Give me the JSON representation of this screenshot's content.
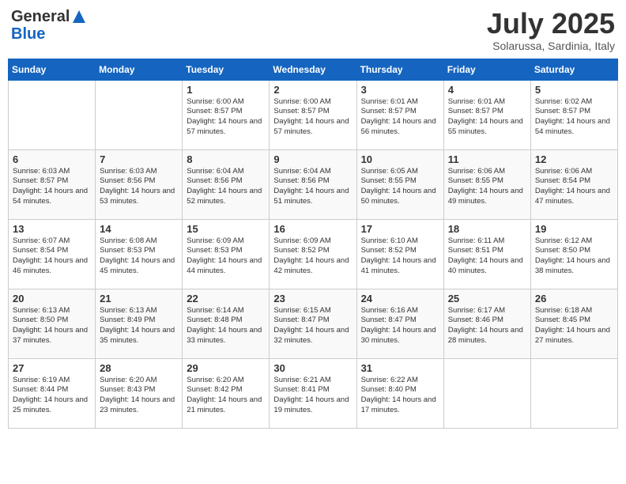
{
  "header": {
    "logo_general": "General",
    "logo_blue": "Blue",
    "month": "July 2025",
    "location": "Solarussa, Sardinia, Italy"
  },
  "days_of_week": [
    "Sunday",
    "Monday",
    "Tuesday",
    "Wednesday",
    "Thursday",
    "Friday",
    "Saturday"
  ],
  "weeks": [
    [
      {
        "day": "",
        "info": ""
      },
      {
        "day": "",
        "info": ""
      },
      {
        "day": "1",
        "info": "Sunrise: 6:00 AM\nSunset: 8:57 PM\nDaylight: 14 hours and 57 minutes."
      },
      {
        "day": "2",
        "info": "Sunrise: 6:00 AM\nSunset: 8:57 PM\nDaylight: 14 hours and 57 minutes."
      },
      {
        "day": "3",
        "info": "Sunrise: 6:01 AM\nSunset: 8:57 PM\nDaylight: 14 hours and 56 minutes."
      },
      {
        "day": "4",
        "info": "Sunrise: 6:01 AM\nSunset: 8:57 PM\nDaylight: 14 hours and 55 minutes."
      },
      {
        "day": "5",
        "info": "Sunrise: 6:02 AM\nSunset: 8:57 PM\nDaylight: 14 hours and 54 minutes."
      }
    ],
    [
      {
        "day": "6",
        "info": "Sunrise: 6:03 AM\nSunset: 8:57 PM\nDaylight: 14 hours and 54 minutes."
      },
      {
        "day": "7",
        "info": "Sunrise: 6:03 AM\nSunset: 8:56 PM\nDaylight: 14 hours and 53 minutes."
      },
      {
        "day": "8",
        "info": "Sunrise: 6:04 AM\nSunset: 8:56 PM\nDaylight: 14 hours and 52 minutes."
      },
      {
        "day": "9",
        "info": "Sunrise: 6:04 AM\nSunset: 8:56 PM\nDaylight: 14 hours and 51 minutes."
      },
      {
        "day": "10",
        "info": "Sunrise: 6:05 AM\nSunset: 8:55 PM\nDaylight: 14 hours and 50 minutes."
      },
      {
        "day": "11",
        "info": "Sunrise: 6:06 AM\nSunset: 8:55 PM\nDaylight: 14 hours and 49 minutes."
      },
      {
        "day": "12",
        "info": "Sunrise: 6:06 AM\nSunset: 8:54 PM\nDaylight: 14 hours and 47 minutes."
      }
    ],
    [
      {
        "day": "13",
        "info": "Sunrise: 6:07 AM\nSunset: 8:54 PM\nDaylight: 14 hours and 46 minutes."
      },
      {
        "day": "14",
        "info": "Sunrise: 6:08 AM\nSunset: 8:53 PM\nDaylight: 14 hours and 45 minutes."
      },
      {
        "day": "15",
        "info": "Sunrise: 6:09 AM\nSunset: 8:53 PM\nDaylight: 14 hours and 44 minutes."
      },
      {
        "day": "16",
        "info": "Sunrise: 6:09 AM\nSunset: 8:52 PM\nDaylight: 14 hours and 42 minutes."
      },
      {
        "day": "17",
        "info": "Sunrise: 6:10 AM\nSunset: 8:52 PM\nDaylight: 14 hours and 41 minutes."
      },
      {
        "day": "18",
        "info": "Sunrise: 6:11 AM\nSunset: 8:51 PM\nDaylight: 14 hours and 40 minutes."
      },
      {
        "day": "19",
        "info": "Sunrise: 6:12 AM\nSunset: 8:50 PM\nDaylight: 14 hours and 38 minutes."
      }
    ],
    [
      {
        "day": "20",
        "info": "Sunrise: 6:13 AM\nSunset: 8:50 PM\nDaylight: 14 hours and 37 minutes."
      },
      {
        "day": "21",
        "info": "Sunrise: 6:13 AM\nSunset: 8:49 PM\nDaylight: 14 hours and 35 minutes."
      },
      {
        "day": "22",
        "info": "Sunrise: 6:14 AM\nSunset: 8:48 PM\nDaylight: 14 hours and 33 minutes."
      },
      {
        "day": "23",
        "info": "Sunrise: 6:15 AM\nSunset: 8:47 PM\nDaylight: 14 hours and 32 minutes."
      },
      {
        "day": "24",
        "info": "Sunrise: 6:16 AM\nSunset: 8:47 PM\nDaylight: 14 hours and 30 minutes."
      },
      {
        "day": "25",
        "info": "Sunrise: 6:17 AM\nSunset: 8:46 PM\nDaylight: 14 hours and 28 minutes."
      },
      {
        "day": "26",
        "info": "Sunrise: 6:18 AM\nSunset: 8:45 PM\nDaylight: 14 hours and 27 minutes."
      }
    ],
    [
      {
        "day": "27",
        "info": "Sunrise: 6:19 AM\nSunset: 8:44 PM\nDaylight: 14 hours and 25 minutes."
      },
      {
        "day": "28",
        "info": "Sunrise: 6:20 AM\nSunset: 8:43 PM\nDaylight: 14 hours and 23 minutes."
      },
      {
        "day": "29",
        "info": "Sunrise: 6:20 AM\nSunset: 8:42 PM\nDaylight: 14 hours and 21 minutes."
      },
      {
        "day": "30",
        "info": "Sunrise: 6:21 AM\nSunset: 8:41 PM\nDaylight: 14 hours and 19 minutes."
      },
      {
        "day": "31",
        "info": "Sunrise: 6:22 AM\nSunset: 8:40 PM\nDaylight: 14 hours and 17 minutes."
      },
      {
        "day": "",
        "info": ""
      },
      {
        "day": "",
        "info": ""
      }
    ]
  ]
}
